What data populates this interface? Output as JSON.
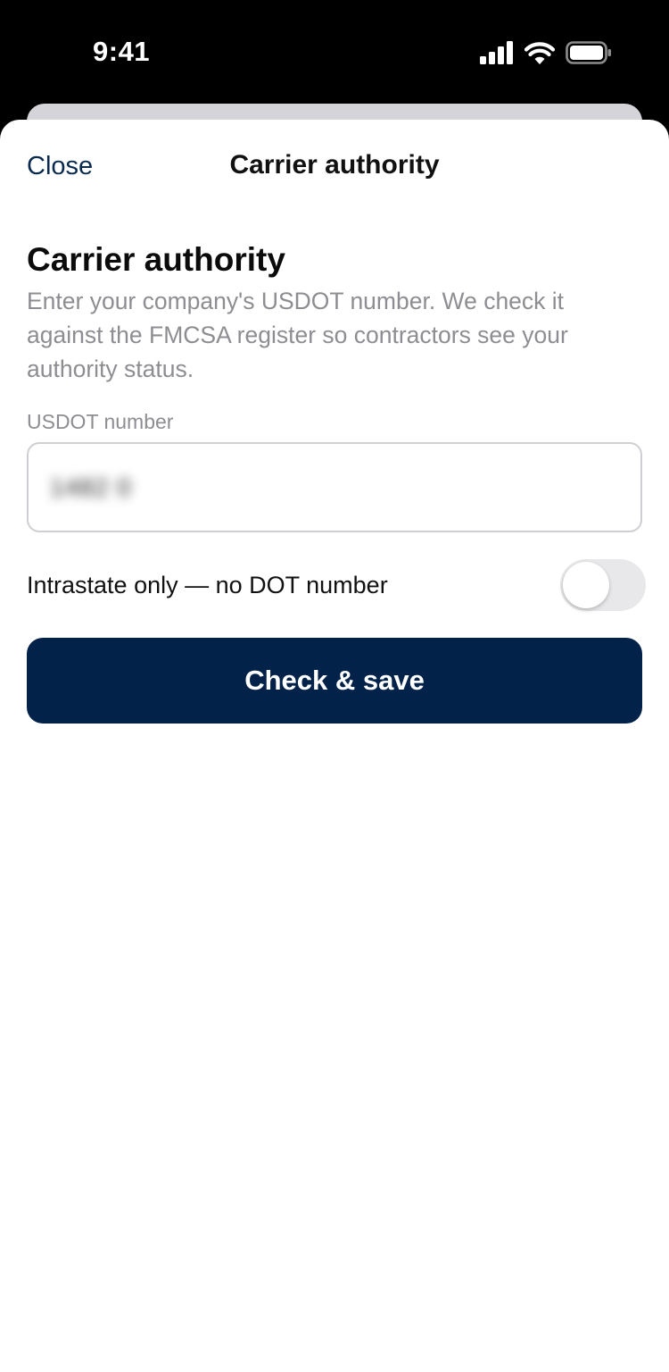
{
  "status_bar": {
    "time": "9:41",
    "icons": [
      "cellular-signal-icon",
      "wifi-icon",
      "battery-icon"
    ]
  },
  "nav": {
    "close_label": "Close",
    "title": "Carrier authority"
  },
  "content": {
    "heading": "Carrier authority",
    "description": "Enter your company's USDOT number. We check it against the FMCSA register so contractors see your authority status."
  },
  "usdot_field": {
    "label": "USDOT number",
    "value": "1482 0"
  },
  "intrastate_toggle": {
    "label": "Intrastate only — no DOT number",
    "on": false
  },
  "submit": {
    "label": "Check & save"
  },
  "colors": {
    "primary": "#03224a",
    "nav_link": "#0a2a50",
    "secondary_text": "#8d8d92"
  }
}
